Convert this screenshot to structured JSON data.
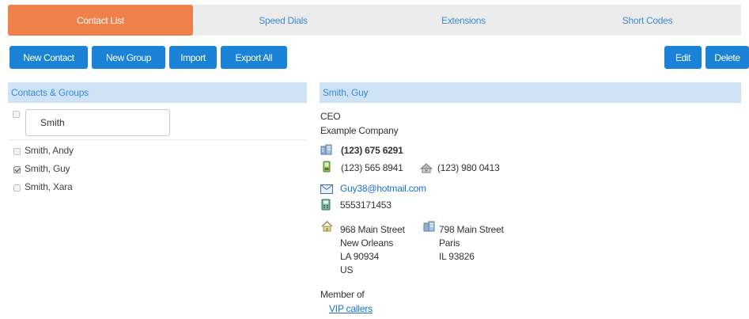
{
  "tabs": [
    {
      "label": "Contact List",
      "active": true
    },
    {
      "label": "Speed Dials",
      "active": false
    },
    {
      "label": "Extensions",
      "active": false
    },
    {
      "label": "Short Codes",
      "active": false
    }
  ],
  "toolbar": {
    "new_contact": "New Contact",
    "new_group": "New Group",
    "import": "Import",
    "export_all": "Export All",
    "edit": "Edit",
    "delete": "Delete"
  },
  "left_panel": {
    "title": "Contacts & Groups",
    "search_value": "Smith",
    "contacts": [
      {
        "name": "Smith, Andy",
        "checked": false
      },
      {
        "name": "Smith, Guy",
        "checked": true
      },
      {
        "name": "Smith, Xara",
        "checked": false
      }
    ]
  },
  "detail": {
    "title": "Smith, Guy",
    "job_title": "CEO",
    "company": "Example Company",
    "work_phone": "(123) 675 6291",
    "mobile_phone": "(123) 565 8941",
    "home_phone": "(123) 980 0413",
    "email": "Guy38@hotmail.com",
    "other_phone": "5553171453",
    "home_address": {
      "street": "968 Main Street",
      "city": "New Orleans",
      "region": "LA 90934",
      "country": "US"
    },
    "work_address": {
      "street": "798 Main Street",
      "city": "Paris",
      "region": "IL 93826"
    },
    "member_of_label": "Member of",
    "groups": [
      "VIP callers"
    ]
  },
  "colors": {
    "accent_orange": "#f0804a",
    "button_blue": "#1a83d8",
    "header_blue": "#cfe3f6",
    "link_blue": "#1a6fd6"
  }
}
